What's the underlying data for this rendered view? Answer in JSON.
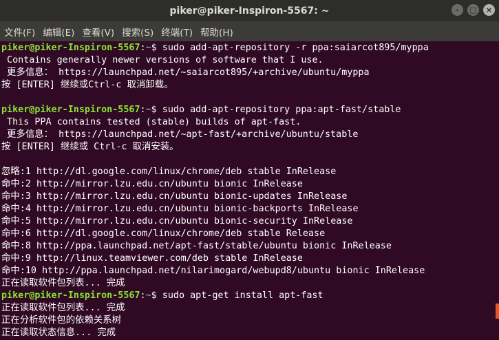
{
  "window": {
    "title": "piker@piker-Inspiron-5567: ~",
    "minimize_glyph": "–",
    "maximize_glyph": "□",
    "close_glyph": "×"
  },
  "menubar": {
    "items": [
      "文件(F)",
      "编辑(E)",
      "查看(V)",
      "搜索(S)",
      "终端(T)",
      "帮助(H)"
    ]
  },
  "terminal": {
    "lines": [
      {
        "user": "piker@piker-Inspiron-5567",
        "sep": ":",
        "path": "~",
        "cmd": "$ sudo add-apt-repository -r ppa:saiarcot895/myppa"
      },
      {
        "text": " Contains generally newer versions of software that I use."
      },
      {
        "text": " 更多信息： https://launchpad.net/~saiarcot895/+archive/ubuntu/myppa"
      },
      {
        "text": "按 [ENTER] 继续或Ctrl-c 取消卸载。"
      },
      {
        "text": ""
      },
      {
        "user": "piker@piker-Inspiron-5567",
        "sep": ":",
        "path": "~",
        "cmd": "$ sudo add-apt-repository ppa:apt-fast/stable"
      },
      {
        "text": " This PPA contains tested (stable) builds of apt-fast."
      },
      {
        "text": " 更多信息： https://launchpad.net/~apt-fast/+archive/ubuntu/stable"
      },
      {
        "text": "按 [ENTER] 继续或 Ctrl-c 取消安装。"
      },
      {
        "text": ""
      },
      {
        "text": "忽略:1 http://dl.google.com/linux/chrome/deb stable InRelease"
      },
      {
        "text": "命中:2 http://mirror.lzu.edu.cn/ubuntu bionic InRelease"
      },
      {
        "text": "命中:3 http://mirror.lzu.edu.cn/ubuntu bionic-updates InRelease"
      },
      {
        "text": "命中:4 http://mirror.lzu.edu.cn/ubuntu bionic-backports InRelease"
      },
      {
        "text": "命中:5 http://mirror.lzu.edu.cn/ubuntu bionic-security InRelease"
      },
      {
        "text": "命中:6 http://dl.google.com/linux/chrome/deb stable Release"
      },
      {
        "text": "命中:8 http://ppa.launchpad.net/apt-fast/stable/ubuntu bionic InRelease"
      },
      {
        "text": "命中:9 http://linux.teamviewer.com/deb stable InRelease"
      },
      {
        "text": "命中:10 http://ppa.launchpad.net/nilarimogard/webupd8/ubuntu bionic InRelease"
      },
      {
        "text": "正在读取软件包列表... 完成"
      },
      {
        "user": "piker@piker-Inspiron-5567",
        "sep": ":",
        "path": "~",
        "cmd": "$ sudo apt-get install apt-fast"
      },
      {
        "text": "正在读取软件包列表... 完成"
      },
      {
        "text": "正在分析软件包的依赖关系树"
      },
      {
        "text": "正在读取状态信息... 完成"
      }
    ]
  },
  "colors": {
    "background": "#300a24",
    "prompt_user": "#8ae234",
    "prompt_path": "#729fcf",
    "scrollbar": "#e95420"
  }
}
